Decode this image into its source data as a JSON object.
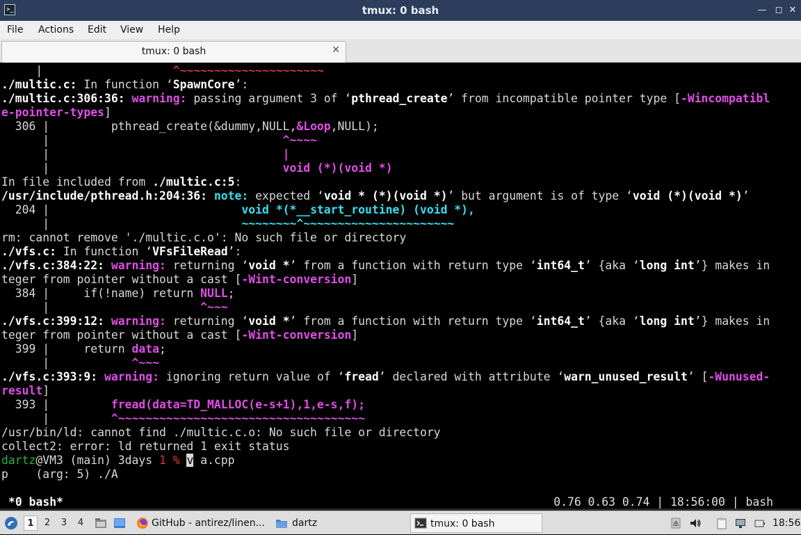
{
  "window": {
    "title": "tmux: 0 bash",
    "icon": "terminal-icon",
    "minimize": "—",
    "maximize": "◻",
    "close": "✕"
  },
  "menu": {
    "items": [
      "File",
      "Actions",
      "Edit",
      "View",
      "Help"
    ]
  },
  "tab": {
    "label": "tmux: 0 bash",
    "close": "✕"
  },
  "terminal": {
    "l0": {
      "a": "     |",
      "b": "                   ^~~~~~~~~~~~~~~~~~~~~~"
    },
    "l1": {
      "a": "./multic.c:",
      "b": " In function ‘",
      "c": "SpawnCore",
      "d": "’:"
    },
    "l2": {
      "a": "./multic.c:306:36: ",
      "b": "warning: ",
      "c": "passing argument 3 of ‘",
      "d": "pthread_create",
      "e": "’ from incompatible pointer type [",
      "f": "-Wincompatibl"
    },
    "l3": {
      "a": "e-pointer-types",
      "b": "]"
    },
    "l4": {
      "a": "  306 |         pthread_create(&dummy,NULL,",
      "b": "&Loop",
      "c": ",NULL);"
    },
    "l5": {
      "a": "      |                                  ",
      "b": "^~~~~"
    },
    "l6": {
      "a": "      |                                  ",
      "b": "|"
    },
    "l7": {
      "a": "      |                                  ",
      "b": "void (*)(void *)"
    },
    "l8": {
      "a": "In file included from ",
      "b": "./multic.c:5",
      "c": ":"
    },
    "l9": {
      "a": "/usr/include/pthread.h:204:36: ",
      "b": "note: ",
      "c": "expected ‘",
      "d": "void * (*)(void *)",
      "e": "’ but argument is of type ‘",
      "f": "void (*)(void *)",
      "g": "’"
    },
    "l10": {
      "a": "  204 |                            ",
      "b": "void *(*__start_routine) (void *),"
    },
    "l11": {
      "a": "      |                            ",
      "b": "~~~~~~~~^~~~~~~~~~~~~~~~~~~~~~~"
    },
    "l12": {
      "a": "rm: cannot remove './multic.c.o': No such file or directory"
    },
    "l13": {
      "a": "./vfs.c:",
      "b": " In function ‘",
      "c": "VFsFileRead",
      "d": "’:"
    },
    "l14": {
      "a": "./vfs.c:384:22: ",
      "b": "warning: ",
      "c": "returning ‘",
      "d": "void *",
      "e": "’ from a function with return type ‘",
      "f": "int64_t",
      "g": "’ {aka ‘",
      "h": "long int",
      "i": "’} makes in"
    },
    "l15": {
      "a": "teger from pointer without a cast [",
      "b": "-Wint-conversion",
      "c": "]"
    },
    "l16": {
      "a": "  384 |     if(!name) return ",
      "b": "NULL",
      "c": ";"
    },
    "l17": {
      "a": "      |                      ",
      "b": "^~~~"
    },
    "l18": {
      "a": "./vfs.c:399:12: ",
      "b": "warning: ",
      "c": "returning ‘",
      "d": "void *",
      "e": "’ from a function with return type ‘",
      "f": "int64_t",
      "g": "’ {aka ‘",
      "h": "long int",
      "i": "’} makes in"
    },
    "l19": {
      "a": "teger from pointer without a cast [",
      "b": "-Wint-conversion",
      "c": "]"
    },
    "l20": {
      "a": "  399 |     return ",
      "b": "data",
      "c": ";"
    },
    "l21": {
      "a": "      |            ",
      "b": "^~~~"
    },
    "l22": {
      "a": "./vfs.c:393:9: ",
      "b": "warning: ",
      "c": "ignoring return value of ‘",
      "d": "fread",
      "e": "’ declared with attribute ‘",
      "f": "warn_unused_result",
      "g": "’ [",
      "h": "-Wunused-"
    },
    "l23": {
      "a": "result",
      "b": "]"
    },
    "l24": {
      "a": "  393 |         ",
      "b": "fread(data=TD_MALLOC(e-s+1),1,e-s,f);"
    },
    "l25": {
      "a": "      |         ",
      "b": "^~~~~~~~~~~~~~~~~~~~~~~~~~~~~~~~~~~~~"
    },
    "l26": {
      "a": "/usr/bin/ld: cannot find ./multic.c.o: No such file or directory"
    },
    "l27": {
      "a": "collect2: error: ld returned 1 exit status"
    },
    "l28": {
      "a": "dartz",
      "b": "@VM3 (main) 3days ",
      "c": "1",
      "d": " % ",
      "e": "v",
      "f": " a.cpp"
    },
    "l29": {
      "a": "p    (arg: 5) ./A"
    }
  },
  "tmux_status": {
    "left": "*0 bash*",
    "right": "0.76 0.63 0.74 | 18:56:00 | bash"
  },
  "taskbar": {
    "start_icon": "start-menu-icon",
    "workspaces": [
      "1",
      "2",
      "3",
      "4"
    ],
    "tasks": [
      {
        "label": "GitHub - antirez/linen...",
        "icon": "firefox-icon"
      },
      {
        "label": "dartz",
        "icon": "folder-icon"
      },
      {
        "label": "tmux: 0 bash",
        "icon": "terminal-icon"
      }
    ],
    "clock": "18:56",
    "colors": {
      "accent": "#2c3e5c",
      "terminal_bg": "#000000",
      "warning": "#e04ee6",
      "note": "#35e0f0"
    }
  }
}
